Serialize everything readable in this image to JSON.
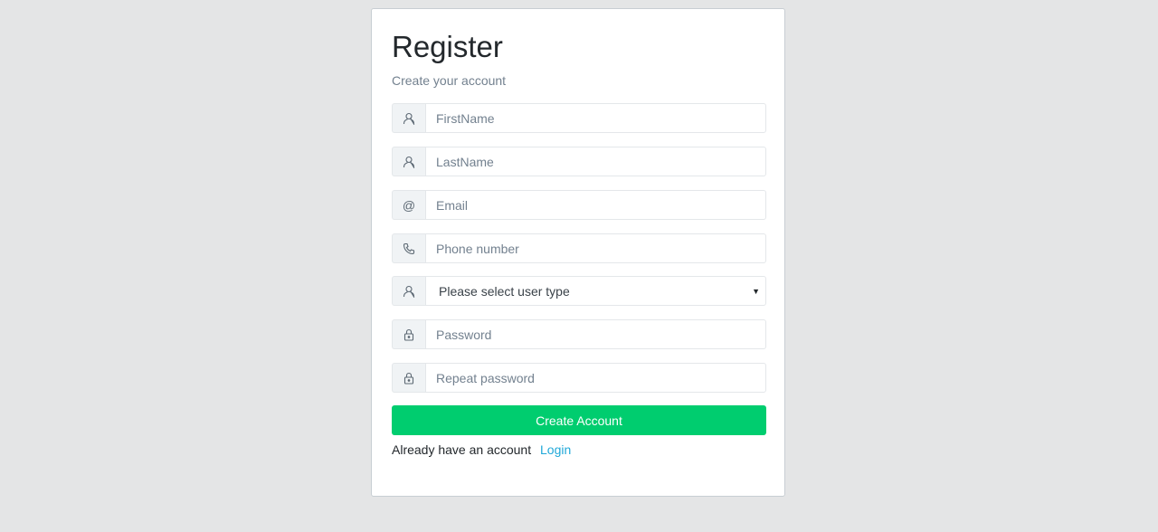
{
  "form": {
    "title": "Register",
    "subtitle": "Create your account",
    "fields": [
      {
        "icon": "user-icon",
        "placeholder": "FirstName"
      },
      {
        "icon": "user-icon",
        "placeholder": "LastName"
      },
      {
        "icon": "at-sign-icon",
        "icon_text": "@",
        "placeholder": "Email"
      },
      {
        "icon": "phone-icon",
        "placeholder": "Phone number"
      },
      {
        "icon": "user-icon",
        "selected": "Please select user type"
      },
      {
        "icon": "lock-icon",
        "placeholder": "Password"
      },
      {
        "icon": "lock-icon",
        "placeholder": "Repeat password"
      }
    ],
    "submit_label": "Create Account",
    "footer_text": "Already have an account",
    "login_link": "Login"
  },
  "colors": {
    "background": "#e4e5e6",
    "button": "#00cd6f",
    "link": "#20a8d8"
  }
}
